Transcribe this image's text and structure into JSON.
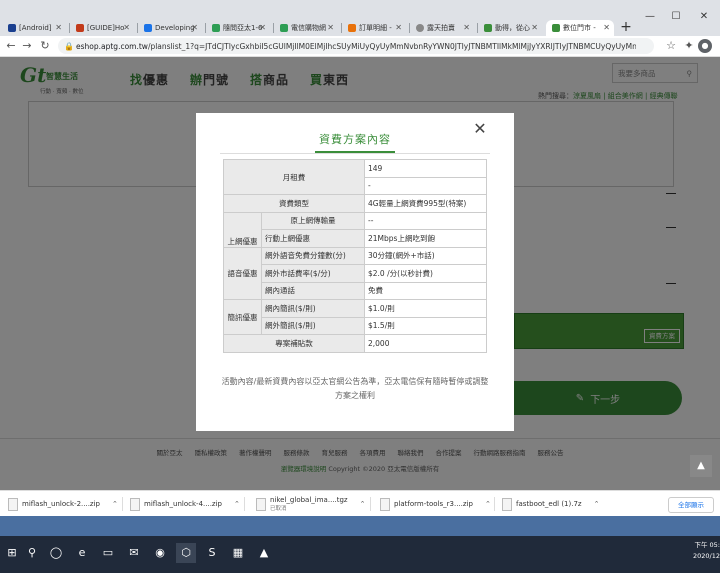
{
  "browser": {
    "tabs": [
      {
        "label": "[Android] ",
        "fav": "#1a3f8f",
        "active": false
      },
      {
        "label": "[GUIDE]Ho",
        "fav": "#c23a1a",
        "active": false
      },
      {
        "label": "Developing",
        "fav": "#1a73e8",
        "active": false
      },
      {
        "label": "隨問亞太1-6",
        "fav": "#2e9e55",
        "active": false
      },
      {
        "label": "電信購物網",
        "fav": "#2e9e55",
        "active": false
      },
      {
        "label": "訂單明細 -",
        "fav": "#e8710a",
        "active": false
      },
      {
        "label": "露天拍賣",
        "fav": "#888888",
        "active": false
      },
      {
        "label": "動得，從心",
        "fav": "#3a8e3a",
        "active": false
      },
      {
        "label": "數位門市 -",
        "fav": "#3a8e3a",
        "active": true
      }
    ],
    "new_tab": "+",
    "window_controls": [
      "—",
      "☐",
      "✕"
    ],
    "url_host": "eshop.aptg.com.tw",
    "url_path": "/planslist_1?q=JTdCJTIycGxhbiI5cGUlMjIlM0ElMjIhcSUyMiUyQyUyMmNvbnRyYWN0JTIyJTNBMTIlMkMlMjJyYXRlJTIyJTNBMCUyQyUyMnByb21v..."
  },
  "site": {
    "logo_mark": "Gt",
    "logo_name": "智慧生活",
    "logo_tagline": "行動 · 寬頻 · 數位",
    "nav": [
      {
        "first": "找",
        "rest": "優惠"
      },
      {
        "first": "辦",
        "rest": "門號"
      },
      {
        "first": "搭",
        "rest": "商品"
      },
      {
        "first": "買",
        "rest": "東西"
      }
    ],
    "search_placeholder": "我要多商品",
    "hot_label": "熱門搜尋：",
    "hot_items": "涼夏風扇 | 組合美作網 | 經典傳聯",
    "plan_button": "資費方案",
    "next_button": "下一步",
    "footer_links": [
      "關於亞太",
      "隱私權政策",
      "著作權聲明",
      "服務條款",
      "育兒服務",
      "各項費用",
      "聯絡我們",
      "合作提案",
      "行動網路服務指南",
      "服務公告"
    ],
    "footer_copy_green": "瀏覽器環境說明",
    "footer_copy": "Copyright ©2020 亞太電信版權所有",
    "scroll_top": "▲"
  },
  "modal": {
    "title": "資費方案內容",
    "close": "✕",
    "rows": {
      "monthly_fee": {
        "label": "月租費",
        "value1": "149",
        "value2": "-"
      },
      "plan_type": {
        "label": "資費類型",
        "value": "4G輕量上網資費995型(特案)"
      },
      "original_data": {
        "label": "原上網傳輸量",
        "value": "--"
      },
      "data_group": "上網優惠",
      "mobile_data": {
        "label": "行動上網優惠",
        "value": "21Mbps上網吃到飽"
      },
      "voice_group": "語音優惠",
      "offnet_minutes": {
        "label": "網外語音免費分鐘數(分)",
        "value": "30分鐘(網外+市話)"
      },
      "offnet_rate": {
        "label": "網外市話費率($/分)",
        "value": "$2.0 /分(以秒計費)"
      },
      "onnet_call": {
        "label": "網內通話",
        "value": "免費"
      },
      "sms_group": "簡訊優惠",
      "onnet_sms": {
        "label": "網內簡訊($/則)",
        "value": "$1.0/則"
      },
      "offnet_sms": {
        "label": "網外簡訊($/則)",
        "value": "$1.5/則"
      },
      "subsidy": {
        "label": "專案補貼款",
        "value": "2,000"
      }
    },
    "note": "活動內容/最新資費內容以亞太官網公告為準，亞太電信保有隨時暫停或調整方案之權利"
  },
  "downloads": {
    "items": [
      {
        "name": "miflash_unlock-2....zip",
        "sub": ""
      },
      {
        "name": "miflash_unlock-4....zip",
        "sub": ""
      },
      {
        "name": "nikel_global_ima....tgz",
        "sub": "已取消"
      },
      {
        "name": "platform-tools_r3....zip",
        "sub": ""
      },
      {
        "name": "fastboot_edl (1).7z",
        "sub": ""
      }
    ],
    "show_all": "全部顯示"
  },
  "taskbar": {
    "icons": [
      "⊞",
      "⚲",
      "◯",
      "e",
      "▭",
      "✉",
      "◉",
      "⬡",
      "S",
      "▦",
      "▲"
    ],
    "time": "下午 05:",
    "date": "2020/12"
  },
  "colors": {
    "brand_green": "#3a8e3a"
  }
}
